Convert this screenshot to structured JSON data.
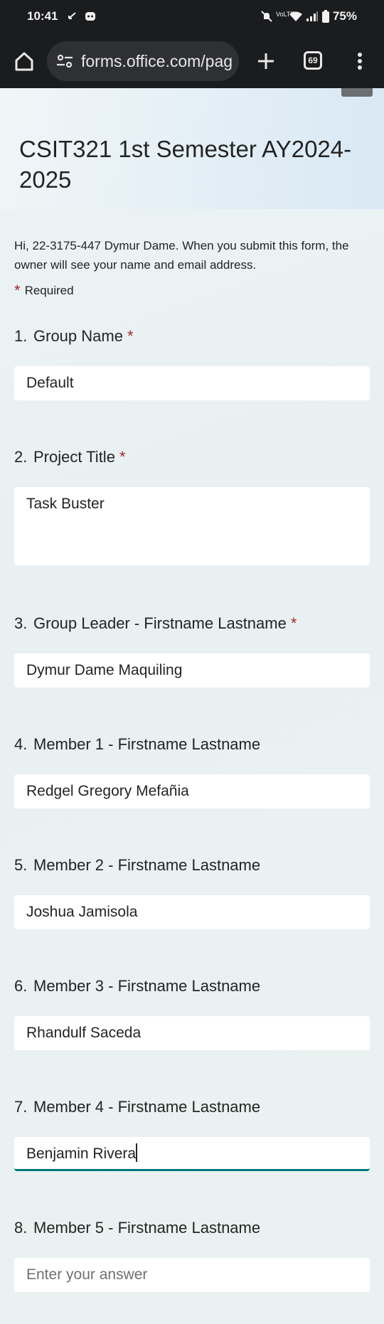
{
  "status_bar": {
    "time": "10:41",
    "battery": "75%",
    "icons": [
      "call-icon",
      "android-app-icon",
      "mute-icon",
      "volte-icon",
      "wifi-icon",
      "signal-icon",
      "battery-icon"
    ]
  },
  "browser": {
    "url": "forms.office.com/pag",
    "tab_count": "69"
  },
  "form": {
    "title": "CSIT321 1st Semester AY2024-2025",
    "intro": "Hi, 22-3175-447 Dymur Dame. When you submit this form, the owner will see your name and email address.",
    "required_note": "Required",
    "questions": [
      {
        "num": "1.",
        "label": "Group Name",
        "required": "*",
        "value": "Default"
      },
      {
        "num": "2.",
        "label": "Project Title",
        "required": "*",
        "value": "Task Buster"
      },
      {
        "num": "3.",
        "label": "Group Leader - Firstname Lastname",
        "required": "*",
        "value": "Dymur Dame Maquiling"
      },
      {
        "num": "4.",
        "label": "Member 1 - Firstname Lastname",
        "value": "Redgel Gregory Mefañia"
      },
      {
        "num": "5.",
        "label": "Member 2 - Firstname Lastname",
        "value": "Joshua Jamisola"
      },
      {
        "num": "6.",
        "label": "Member 3 - Firstname Lastname",
        "value": "Rhandulf Saceda"
      },
      {
        "num": "7.",
        "label": "Member 4 - Firstname Lastname",
        "value": "Benjamin Rivera"
      },
      {
        "num": "8.",
        "label": "Member 5 - Firstname Lastname",
        "placeholder": "Enter your answer"
      }
    ]
  },
  "colors": {
    "required_star": "#a4262c",
    "focus_underline": "#03787c",
    "chrome_bg": "#1b1c1e"
  }
}
